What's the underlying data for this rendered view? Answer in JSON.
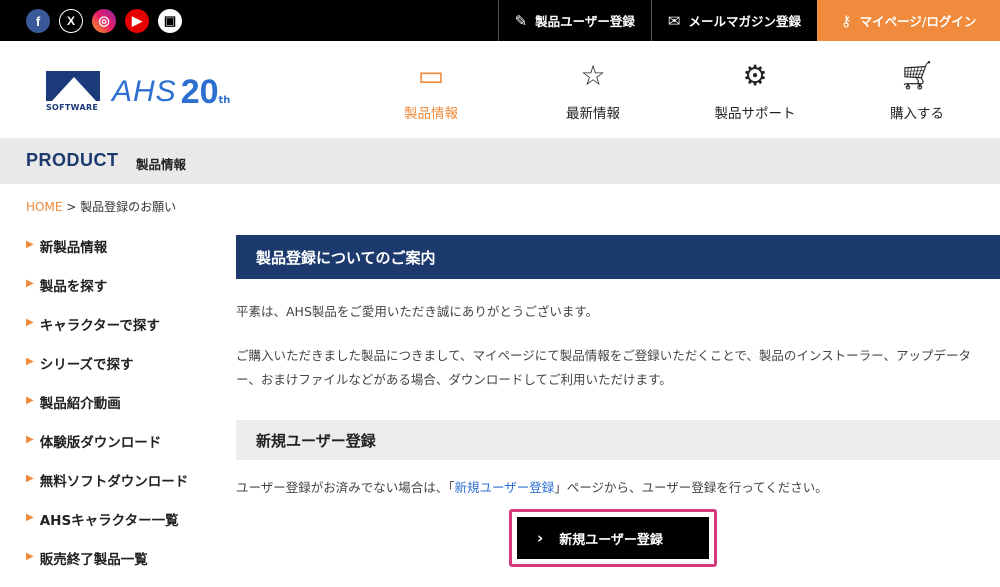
{
  "topbar": {
    "social": [
      {
        "icon": "facebook-icon",
        "glyph": "f"
      },
      {
        "icon": "x-icon",
        "glyph": "X"
      },
      {
        "icon": "instagram-icon",
        "glyph": "◎"
      },
      {
        "icon": "youtube-icon",
        "glyph": "▶"
      },
      {
        "icon": "tv-icon",
        "glyph": "▣"
      }
    ],
    "product_register": "製品ユーザー登録",
    "newsletter": "メールマガジン登録",
    "mypage": "マイページ/ログイン"
  },
  "logo": {
    "software": "SOFTWARE",
    "ahs": "AHS",
    "twenty": "20",
    "th": "th"
  },
  "nav": {
    "products": "製品情報",
    "news": "最新情報",
    "support": "製品サポート",
    "buy": "購入する"
  },
  "band": {
    "en": "PRODUCT",
    "jp": "製品情報"
  },
  "breadcrumb": {
    "home": "HOME",
    "sep": " > ",
    "current": "製品登録のお願い"
  },
  "sidebar": {
    "items": [
      {
        "label": "新製品情報"
      },
      {
        "label": "製品を探す"
      },
      {
        "label": "キャラクターで探す"
      },
      {
        "label": "シリーズで探す"
      },
      {
        "label": "製品紹介動画"
      },
      {
        "label": "体験版ダウンロード"
      },
      {
        "label": "無料ソフトダウンロード"
      },
      {
        "label": "AHSキャラクター一覧"
      },
      {
        "label": "販売終了製品一覧"
      }
    ]
  },
  "main": {
    "heading": "製品登録についてのご案内",
    "para1": "平素は、AHS製品をご愛用いただき誠にありがとうございます。",
    "para2": "ご購入いただきました製品につきまして、マイページにて製品情報をご登録いただくことで、製品のインストーラー、アップデーター、おまけファイルなどがある場合、ダウンロードしてご利用いただけます。",
    "subheading": "新規ユーザー登録",
    "para3_pre": "ユーザー登録がお済みでない場合は、「",
    "para3_link": "新規ユーザー登録",
    "para3_post": "」ページから、ユーザー登録を行ってください。",
    "cta": "新規ユーザー登録"
  },
  "colors": {
    "accent_orange": "#f08a3c",
    "navy": "#1d3a6e",
    "highlight_pink": "#d63a7d",
    "link_blue": "#2c6fd1"
  }
}
